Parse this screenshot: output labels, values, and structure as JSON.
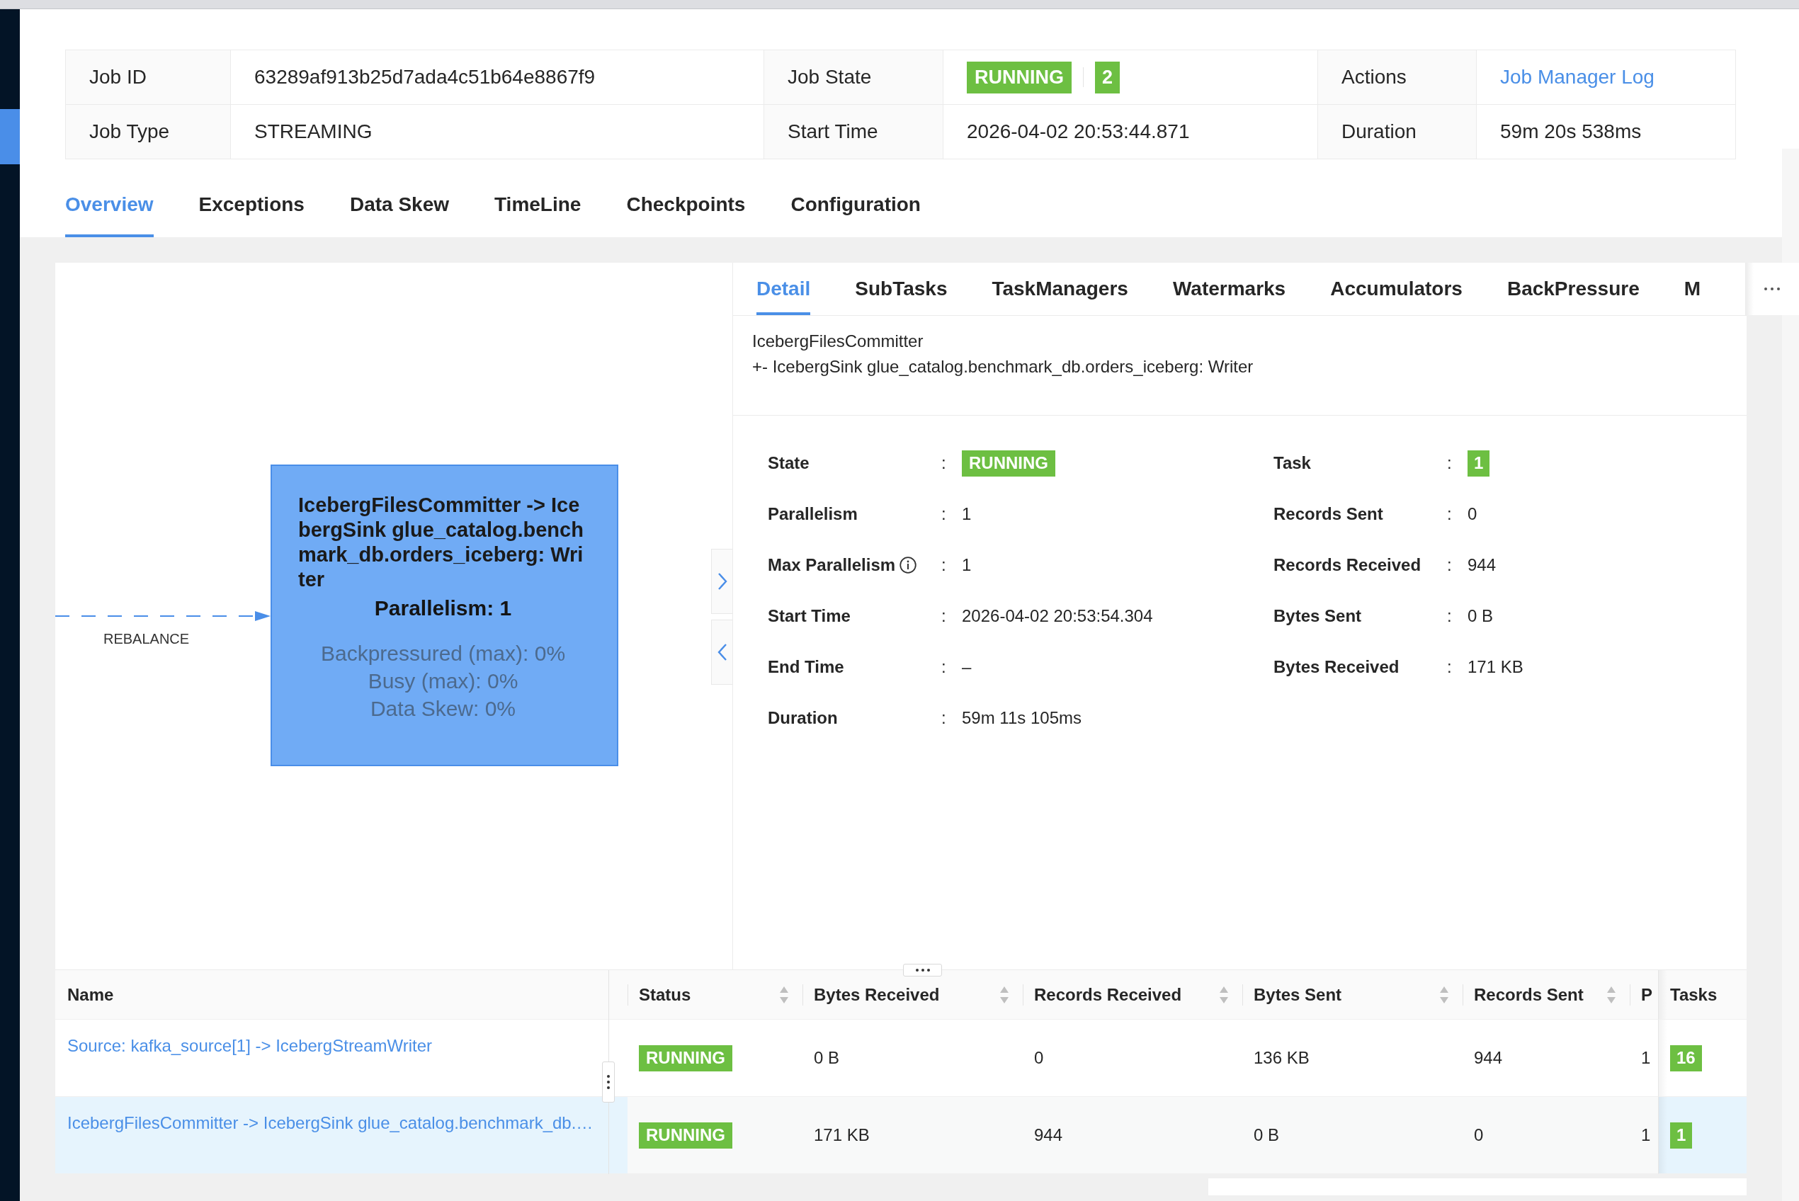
{
  "job_info": [
    {
      "label": "Job ID",
      "kind": "text",
      "value": "63289af913b25d7ada4c51b64e8867f9"
    },
    {
      "label": "Job State",
      "kind": "status",
      "value": "RUNNING",
      "count": "2"
    },
    {
      "label": "Actions",
      "kind": "link",
      "value": "Job Manager Log"
    },
    {
      "label": "Job Type",
      "kind": "text",
      "value": "STREAMING"
    },
    {
      "label": "Start Time",
      "kind": "text",
      "value": "2026-04-02 20:53:44.871"
    },
    {
      "label": "Duration",
      "kind": "text",
      "value": "59m 20s 538ms"
    }
  ],
  "tabs": [
    {
      "label": "Overview",
      "selected": true
    },
    {
      "label": "Exceptions",
      "selected": false
    },
    {
      "label": "Data Skew",
      "selected": false
    },
    {
      "label": "TimeLine",
      "selected": false
    },
    {
      "label": "Checkpoints",
      "selected": false
    },
    {
      "label": "Configuration",
      "selected": false
    }
  ],
  "graph": {
    "edge": {
      "label": "REBALANCE"
    },
    "node": {
      "title": "IcebergFilesCommitter -> IcebergSink glue_catalog.benchmark_db.orders_iceberg: Writer",
      "parallelism": "Parallelism: 1",
      "metrics": [
        "Backpressured (max): 0%",
        "Busy (max): 0%",
        "Data Skew: 0%"
      ]
    }
  },
  "detail_panel": {
    "tabs": [
      {
        "label": "Detail",
        "selected": true
      },
      {
        "label": "SubTasks",
        "selected": false
      },
      {
        "label": "TaskManagers",
        "selected": false
      },
      {
        "label": "Watermarks",
        "selected": false
      },
      {
        "label": "Accumulators",
        "selected": false
      },
      {
        "label": "BackPressure",
        "selected": false
      },
      {
        "label": "M",
        "selected": false
      }
    ],
    "description_lines": [
      "IcebergFilesCommitter",
      "+- IcebergSink glue_catalog.benchmark_db.orders_iceberg: Writer"
    ],
    "fields": [
      {
        "label": "State",
        "colon": ":",
        "kind": "status",
        "value": "RUNNING",
        "info": false
      },
      {
        "label": "Task",
        "colon": ":",
        "kind": "count",
        "value": "1",
        "info": false
      },
      {
        "label": "Parallelism",
        "colon": ":",
        "kind": "text",
        "value": "1",
        "info": false
      },
      {
        "label": "Records Sent",
        "colon": ":",
        "kind": "text",
        "value": "0",
        "info": false
      },
      {
        "label": "Max Parallelism",
        "colon": ":",
        "kind": "text",
        "value": "1",
        "info": true
      },
      {
        "label": "Records Received",
        "colon": ":",
        "kind": "text",
        "value": "944",
        "info": false
      },
      {
        "label": "Start Time",
        "colon": ":",
        "kind": "text",
        "value": "2026-04-02 20:53:54.304",
        "info": false
      },
      {
        "label": "Bytes Sent",
        "colon": ":",
        "kind": "text",
        "value": "0 B",
        "info": false
      },
      {
        "label": "End Time",
        "colon": ":",
        "kind": "text",
        "value": "–",
        "info": false
      },
      {
        "label": "Bytes Received",
        "colon": ":",
        "kind": "text",
        "value": "171 KB",
        "info": false
      },
      {
        "label": "Duration",
        "colon": ":",
        "kind": "text",
        "value": "59m 11s 105ms",
        "info": false
      }
    ]
  },
  "vertex_table": {
    "columns": [
      {
        "label": "Name",
        "kind": "link",
        "sortable": false
      },
      {
        "label": "Status",
        "kind": "status",
        "sortable": true
      },
      {
        "label": "Bytes Received",
        "kind": "text",
        "sortable": true
      },
      {
        "label": "Records Received",
        "kind": "text",
        "sortable": true
      },
      {
        "label": "Bytes Sent",
        "kind": "text",
        "sortable": true
      },
      {
        "label": "Records Sent",
        "kind": "text",
        "sortable": true
      },
      {
        "label": "P",
        "kind": "text",
        "sortable": false
      },
      {
        "label": "Tasks",
        "kind": "count",
        "sortable": false
      }
    ],
    "rows": [
      {
        "selected": false,
        "cells": [
          "Source: kafka_source[1] -> IcebergStreamWriter",
          "RUNNING",
          "0 B",
          "0",
          "136 KB",
          "944",
          "1",
          "16"
        ]
      },
      {
        "selected": true,
        "cells": [
          "IcebergFilesCommitter -> IcebergSink glue_catalog.benchmark_db.…",
          "RUNNING",
          "171 KB",
          "944",
          "0 B",
          "0",
          "1",
          "1"
        ]
      }
    ]
  }
}
